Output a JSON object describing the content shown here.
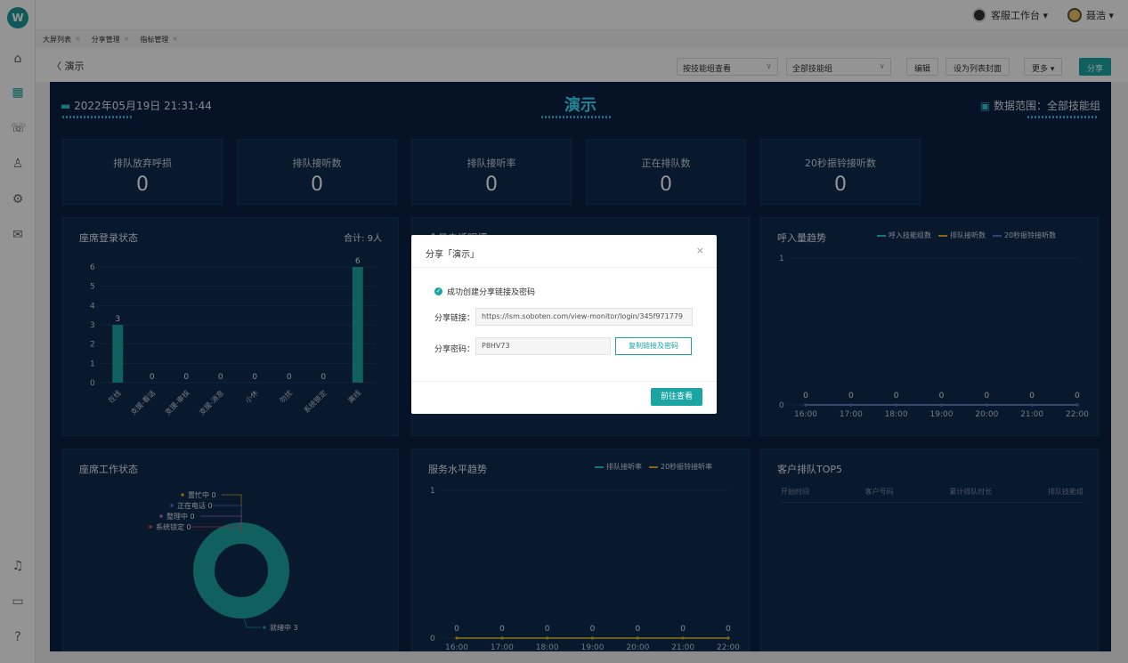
{
  "app": {
    "logo_letter": "W"
  },
  "topbar": {
    "workspace": "客服工作台 ▾",
    "user": "聂浩 ▾"
  },
  "tabs": [
    {
      "label": "大屏列表"
    },
    {
      "label": "分享管理"
    },
    {
      "label": "指标管理"
    }
  ],
  "header": {
    "back_label": "演示",
    "view_select": "按技能组查看",
    "group_select": "全部技能组",
    "edit": "编辑",
    "set_cover": "设为列表封面",
    "more": "更多 ▾",
    "share": "分享"
  },
  "dashboard": {
    "datetime": "2022年05月19日 21:31:44",
    "title": "演示",
    "range": "数据范围：全部技能组",
    "kpis": [
      {
        "label": "排队放弃呼损",
        "value": "0"
      },
      {
        "label": "排队接听数",
        "value": "0"
      },
      {
        "label": "排队接听率",
        "value": "0"
      },
      {
        "label": "正在排队数",
        "value": "0"
      },
      {
        "label": "20秒振铃接听数",
        "value": "0"
      }
    ],
    "login_status": {
      "title": "座席登录状态",
      "total": "合计: 9人"
    },
    "today_calls": {
      "title": "今日电话明细"
    },
    "inbound_trend": {
      "title": "呼入量趋势",
      "legend": [
        "呼入技能组数",
        "排队接听数",
        "20秒振铃接听数"
      ]
    },
    "work_status": {
      "title": "座席工作状态"
    },
    "service_trend": {
      "title": "服务水平趋势",
      "legend": [
        "排队接听率",
        "20秒振铃接听率"
      ]
    },
    "queue_top": {
      "title": "客户排队TOP5",
      "columns": [
        "开始时间",
        "客户号码",
        "累计排队时长",
        "排队技能组"
      ]
    }
  },
  "chart_data": [
    {
      "type": "bar",
      "title": "座席登录状态",
      "categories": [
        "在线",
        "支援-看话",
        "支援-审核",
        "支援-消息",
        "小休",
        "勿扰",
        "系统锁定",
        "离线"
      ],
      "values": [
        3,
        0,
        0,
        0,
        0,
        0,
        0,
        6
      ],
      "ylim": [
        0,
        6
      ],
      "yticks": [
        "0",
        "1",
        "2",
        "3",
        "4",
        "5",
        "6"
      ],
      "color": "#1aa5a2"
    },
    {
      "type": "line",
      "title": "呼入量趋势",
      "x": [
        "16:00",
        "17:00",
        "18:00",
        "19:00",
        "20:00",
        "21:00",
        "22:00"
      ],
      "series": [
        {
          "name": "呼入技能组数",
          "values": [
            0,
            0,
            0,
            0,
            0,
            0,
            0
          ],
          "color": "#2bc7d8"
        },
        {
          "name": "排队接听数",
          "values": [
            0,
            0,
            0,
            0,
            0,
            0,
            0
          ],
          "color": "#e0b020"
        },
        {
          "name": "20秒振铃接听数",
          "values": [
            0,
            0,
            0,
            0,
            0,
            0,
            0
          ],
          "color": "#5b6fe0"
        }
      ],
      "ylim": [
        0,
        1
      ],
      "yticks": [
        "0",
        "1"
      ]
    },
    {
      "type": "pie",
      "title": "座席工作状态",
      "slices": [
        {
          "label": "置忙中",
          "value": 0,
          "color": "#e0b020"
        },
        {
          "label": "正在电话",
          "value": 0,
          "color": "#5b6fe0"
        },
        {
          "label": "整理中",
          "value": 0,
          "color": "#b86de0"
        },
        {
          "label": "系统锁定",
          "value": 0,
          "color": "#e05050"
        },
        {
          "label": "就绪中",
          "value": 3,
          "color": "#1aa5a2"
        }
      ]
    },
    {
      "type": "line",
      "title": "服务水平趋势",
      "x": [
        "16:00",
        "17:00",
        "18:00",
        "19:00",
        "20:00",
        "21:00",
        "22:00"
      ],
      "series": [
        {
          "name": "排队接听率",
          "values": [
            0,
            0,
            0,
            0,
            0,
            0,
            0
          ],
          "color": "#2bc7d8"
        },
        {
          "name": "20秒振铃接听率",
          "values": [
            0,
            0,
            0,
            0,
            0,
            0,
            0
          ],
          "color": "#e0b020"
        }
      ],
      "ylim": [
        0,
        1
      ],
      "yticks": [
        "0",
        "1"
      ]
    }
  ],
  "modal": {
    "title": "分享「演示」",
    "close": "×",
    "success": "成功创建分享链接及密码",
    "link_label": "分享链接：",
    "link_value": "https://lsm.soboten.com/view-monitor/login/345f971779",
    "pwd_label": "分享密码：",
    "pwd_value": "P8HV73",
    "copy_btn": "复制链接及密码",
    "go_btn": "前往查看"
  }
}
